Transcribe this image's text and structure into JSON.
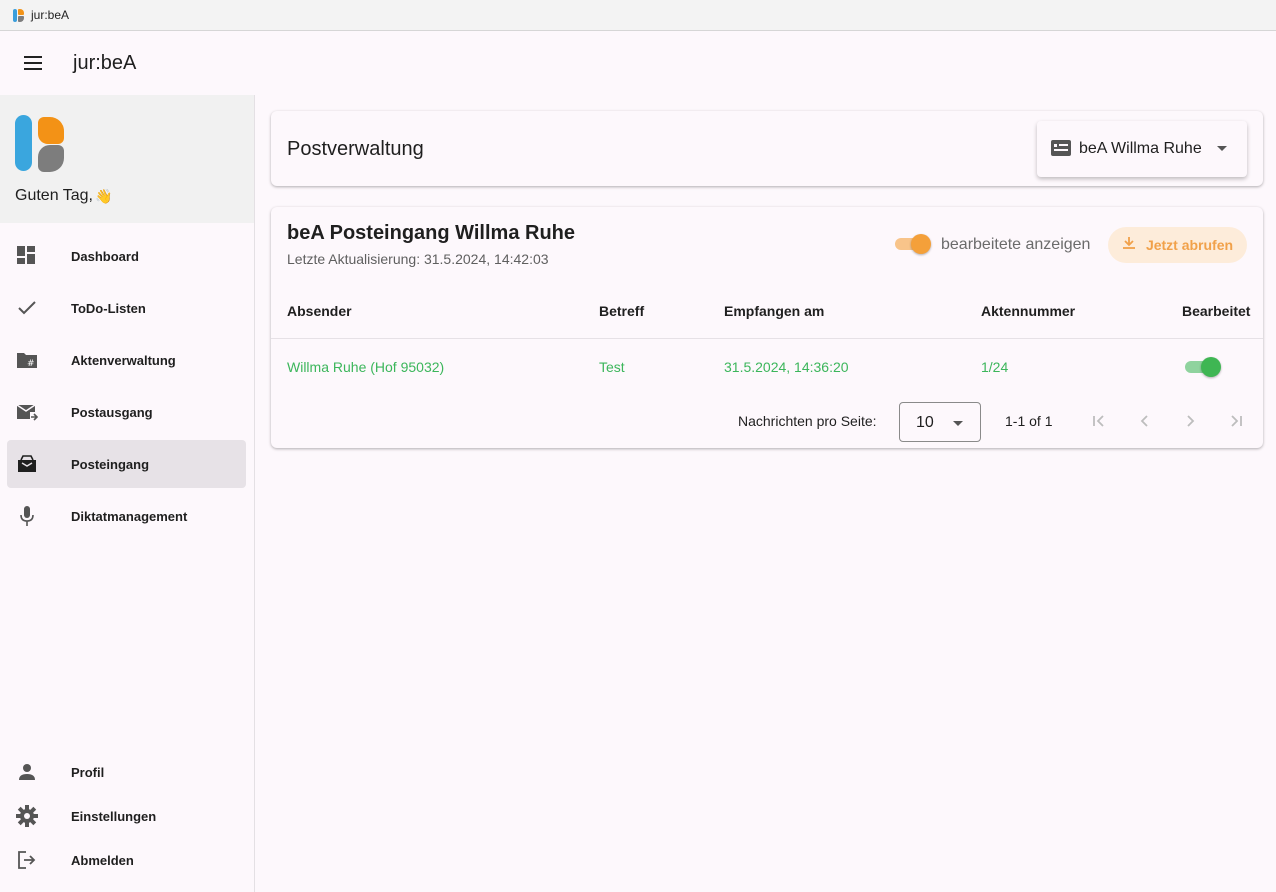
{
  "window": {
    "title": "jur:beA"
  },
  "appbar": {
    "title": "jur:beA"
  },
  "sidebar": {
    "greeting": "Guten Tag,",
    "greeting_emoji": "👋",
    "items": [
      {
        "label": "Dashboard",
        "icon": "dashboard-icon"
      },
      {
        "label": "ToDo-Listen",
        "icon": "check-icon"
      },
      {
        "label": "Aktenverwaltung",
        "icon": "folder-hash-icon"
      },
      {
        "label": "Postausgang",
        "icon": "mail-send-icon"
      },
      {
        "label": "Posteingang",
        "icon": "inbox-icon",
        "active": true
      },
      {
        "label": "Diktatmanagement",
        "icon": "microphone-icon"
      }
    ],
    "bottom_items": [
      {
        "label": "Profil",
        "icon": "person-icon"
      },
      {
        "label": "Einstellungen",
        "icon": "gear-icon"
      },
      {
        "label": "Abmelden",
        "icon": "logout-icon"
      }
    ]
  },
  "postverwaltung": {
    "title": "Postverwaltung",
    "postbox_selected": "beA Willma Ruhe"
  },
  "inbox": {
    "title": "beA Posteingang Willma Ruhe",
    "last_update": "Letzte Aktualisierung: 31.5.2024, 14:42:03",
    "show_edited_label": "bearbeitete anzeigen",
    "show_edited_on": true,
    "fetch_label": "Jetzt abrufen",
    "columns": [
      "Absender",
      "Betreff",
      "Empfangen am",
      "Aktennummer",
      "Bearbeitet"
    ],
    "rows": [
      {
        "sender": "Willma Ruhe (Hof 95032)",
        "subject": "Test",
        "received": "31.5.2024, 14:36:20",
        "file_number": "1/24",
        "edited": true
      }
    ],
    "pagination": {
      "per_page_label": "Nachrichten pro Seite:",
      "per_page": "10",
      "range": "1-1 of 1"
    }
  },
  "colors": {
    "accent_orange": "#f4a03a",
    "accent_green": "#3cb65b",
    "logo_blue": "#3aa6de",
    "logo_orange": "#f39216",
    "logo_gray": "#7d7d7d"
  }
}
